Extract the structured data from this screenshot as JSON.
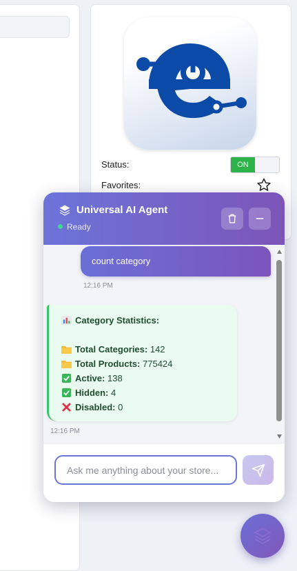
{
  "product": {
    "status_label": "Status:",
    "status_toggle": "ON",
    "favorites_label": "Favorites:"
  },
  "chat": {
    "title": "Universal AI Agent",
    "status": "Ready",
    "messages": {
      "user": {
        "text": "count category",
        "time": "12:16 PM"
      },
      "bot": {
        "title": "Category Statistics:",
        "lines": [
          {
            "label": "Total Categories:",
            "value": "142"
          },
          {
            "label": "Total Products:",
            "value": "775424"
          },
          {
            "label": "Active:",
            "value": "138"
          },
          {
            "label": "Hidden:",
            "value": "4"
          },
          {
            "label": "Disabled:",
            "value": "0"
          }
        ],
        "time": "12:16 PM"
      }
    },
    "input_placeholder": "Ask me anything about your store..."
  },
  "colors": {
    "accent_start": "#6b74d9",
    "accent_end": "#7d55b8",
    "toggle_on": "#2db34a",
    "bot_border": "#3cc46a"
  },
  "icons": [
    "layers-icon",
    "trash-icon",
    "minimize-icon",
    "send-icon",
    "star-icon",
    "chart-emoji-icon",
    "folder-emoji-icon",
    "check-emoji-icon",
    "cross-emoji-icon"
  ]
}
